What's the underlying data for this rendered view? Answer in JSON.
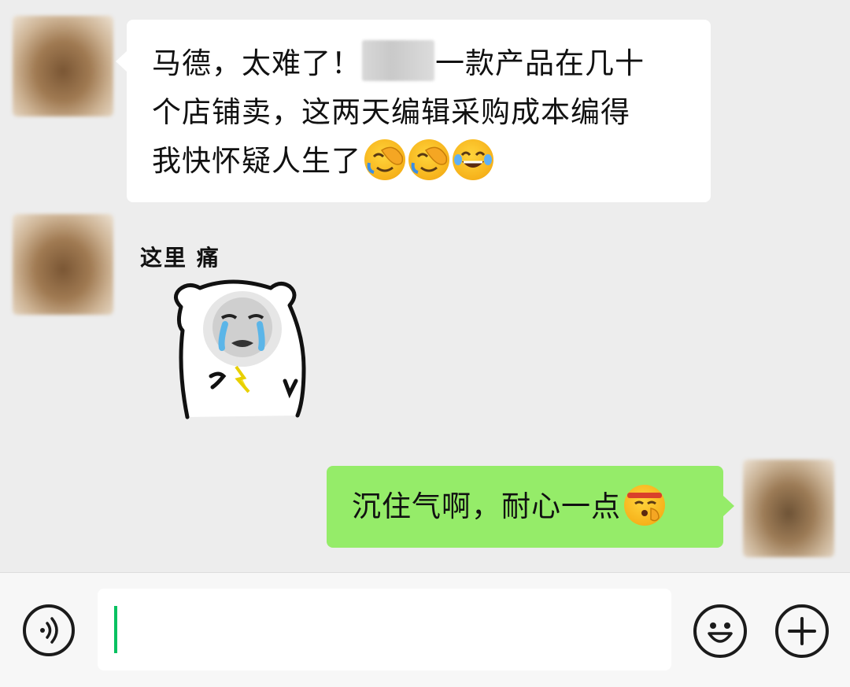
{
  "chat": {
    "messages": [
      {
        "side": "left",
        "type": "text",
        "lines": [
          "马德，太难了！",
          "一款产品在几十",
          "个店铺卖，这两天编辑采购成本编得",
          "我快怀疑人生了"
        ],
        "emojis": [
          "facepalm-emoji",
          "facepalm-emoji",
          "laughing-tears-emoji"
        ]
      },
      {
        "side": "left",
        "type": "sticker",
        "caption": "这里 痛",
        "sticker_name": "crying-bear-sticker"
      },
      {
        "side": "right",
        "type": "text",
        "text": "沉住气啊，耐心一点",
        "emojis": [
          "shushing-headband-emoji"
        ]
      }
    ]
  },
  "input_bar": {
    "voice_icon": "voice-icon",
    "emoji_icon": "smile-icon",
    "plus_icon": "plus-icon",
    "input_value": ""
  },
  "colors": {
    "background": "#ededed",
    "incoming_bubble": "#ffffff",
    "outgoing_bubble": "#95ec69",
    "caret": "#07c160"
  }
}
